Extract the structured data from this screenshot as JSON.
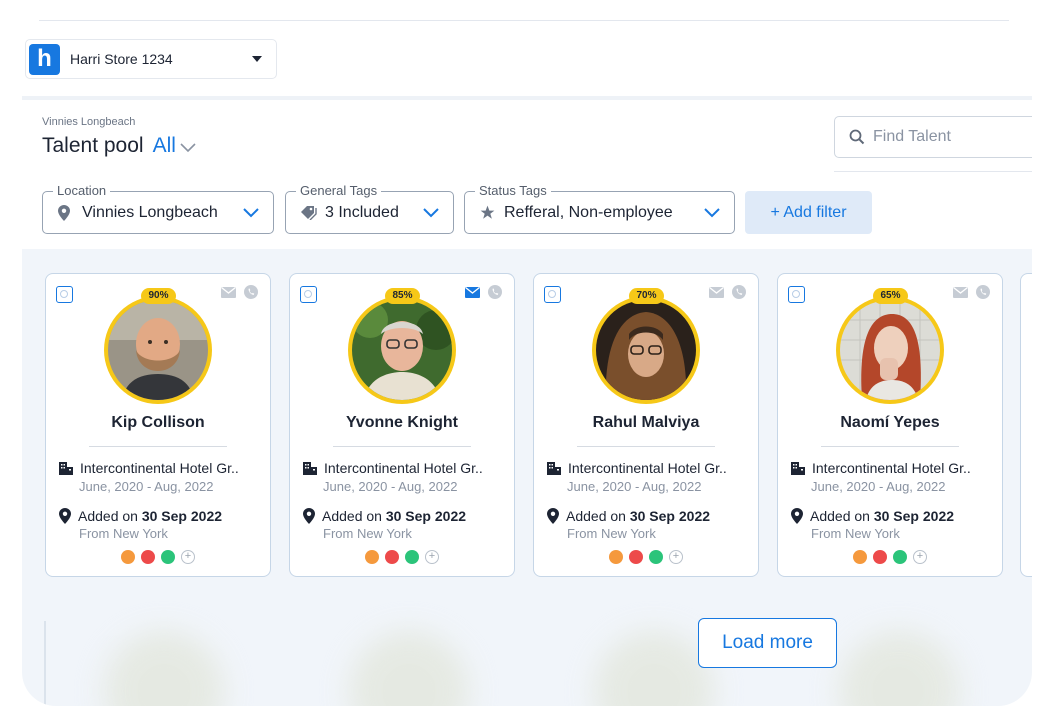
{
  "store_selector": {
    "logo_letter": "h",
    "name": "Harri Store 1234"
  },
  "header": {
    "subtitle": "Vinnies Longbeach",
    "title": "Talent pool",
    "view_filter": "All"
  },
  "search": {
    "placeholder": "Find Talent"
  },
  "filters": [
    {
      "legend": "Location",
      "value": "Vinnies Longbeach",
      "icon": "map-pin-icon"
    },
    {
      "legend": "General Tags",
      "value": "3 Included",
      "icon": "tags-icon"
    },
    {
      "legend": "Status Tags",
      "value": "Refferal, Non-employee",
      "icon": "star-icon"
    }
  ],
  "add_filter_label": "+ Add filter",
  "colors": {
    "accent": "#1778e0",
    "match_ring": "#f6c818",
    "tag_orange": "#f5993d",
    "tag_red": "#ed4a4a",
    "tag_green": "#2bc47a"
  },
  "candidates": [
    {
      "name": "Kip Collison",
      "match": "90%",
      "employer": "Intercontinental Hotel Gr..",
      "dates": "June, 2020 - Aug, 2022",
      "added_prefix": "Added on ",
      "added_date": "30 Sep 2022",
      "from": "From New York",
      "email_active": false
    },
    {
      "name": "Yvonne Knight",
      "match": "85%",
      "employer": "Intercontinental Hotel Gr..",
      "dates": "June, 2020 - Aug, 2022",
      "added_prefix": "Added on ",
      "added_date": "30 Sep 2022",
      "from": "From New York",
      "email_active": true
    },
    {
      "name": "Rahul Malviya",
      "match": "70%",
      "employer": "Intercontinental Hotel Gr..",
      "dates": "June, 2020 - Aug, 2022",
      "added_prefix": "Added on ",
      "added_date": "30 Sep 2022",
      "from": "From New York",
      "email_active": false
    },
    {
      "name": "Naomí Yepes",
      "match": "65%",
      "employer": "Intercontinental Hotel Gr..",
      "dates": "June, 2020 - Aug, 2022",
      "added_prefix": "Added on ",
      "added_date": "30 Sep 2022",
      "from": "From New York",
      "email_active": false
    }
  ],
  "load_more_label": "Load more"
}
